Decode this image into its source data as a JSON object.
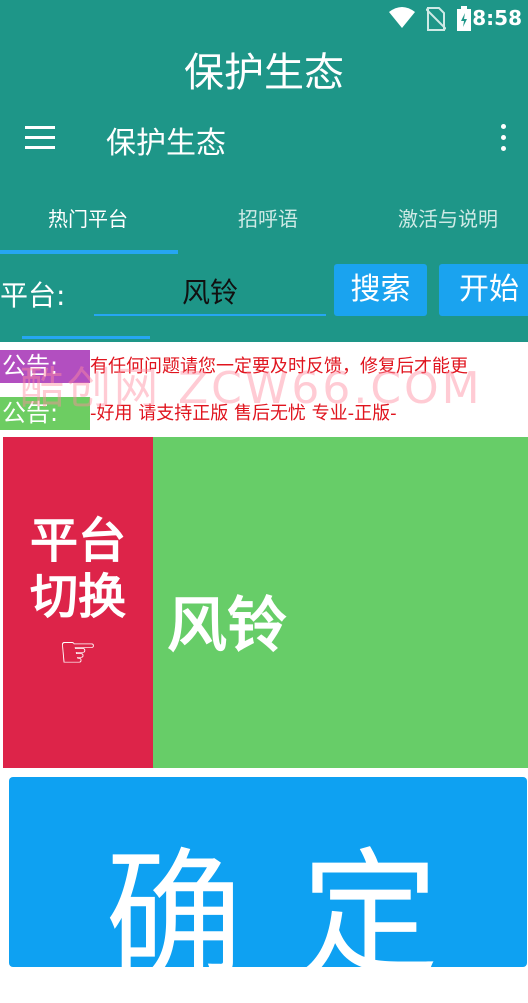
{
  "status_bar": {
    "time": "8:58"
  },
  "app": {
    "title": "保护生态"
  },
  "toolbar": {
    "title": "保护生态"
  },
  "tabs": [
    {
      "label": "热门平台",
      "active": true
    },
    {
      "label": "招呼语",
      "active": false
    },
    {
      "label": "激活与说明",
      "active": false
    }
  ],
  "search": {
    "label": "平台:",
    "value": "风铃",
    "search_button": "搜索",
    "start_button": "开始"
  },
  "notices": [
    {
      "tag": "公告:",
      "text": "有任何问题请您一定要及时反馈，修复后才能更"
    },
    {
      "tag": "公告:",
      "text": "-好用          请支持正版 售后无忧 专业-正版-"
    }
  ],
  "watermark": "酷创网 ZCW66.COM",
  "switcher": {
    "line1": "平台",
    "line2": "切换",
    "hand": "☞"
  },
  "current_platform": "风铃",
  "confirm_label": "确定",
  "colors": {
    "primary": "#1e9688",
    "accent": "#1aa3ef",
    "switch_bg": "#dd2449",
    "platform_bg": "#67cd68",
    "confirm_bg": "#0ea1f2",
    "notice_tag_1": "#b24fc0",
    "notice_tag_2": "#6dcd62"
  }
}
